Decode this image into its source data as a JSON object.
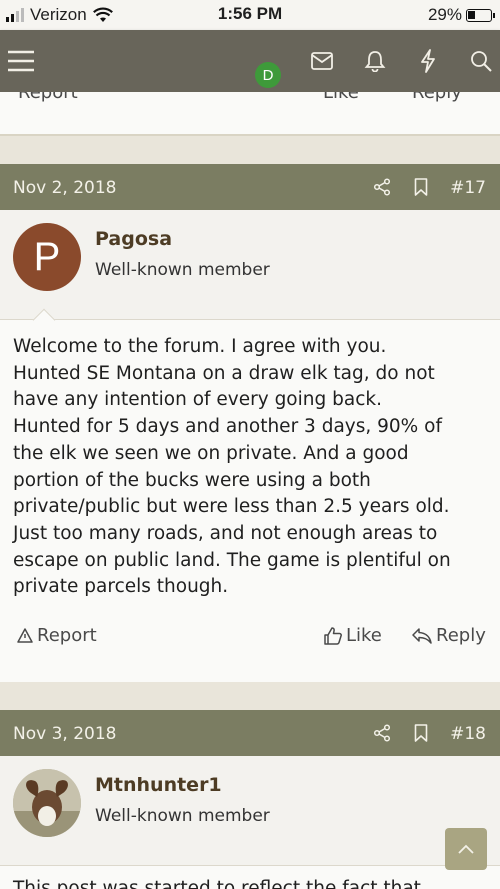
{
  "status_bar": {
    "carrier": "Verizon",
    "time": "1:56 PM",
    "battery": "29%"
  },
  "nav": {
    "user_initial": "D",
    "icons": [
      "menu-icon",
      "inbox-icon",
      "bell-icon",
      "bolt-icon",
      "search-icon"
    ]
  },
  "prev_post": {
    "report": "Report",
    "like": "Like",
    "reply": "Reply"
  },
  "posts": [
    {
      "date": "Nov 2, 2018",
      "number": "#17",
      "avatar_letter": "P",
      "avatar_color": "#8a4a2c",
      "username": "Pagosa",
      "user_title": "Well-known member",
      "lines": [
        "Welcome to the forum. I agree with you.",
        "Hunted SE Montana on a draw elk tag, do not",
        "have any intention of every going back.",
        "Hunted for 5 days and another 3 days, 90% of",
        "the elk we seen we on private. And a good",
        "portion of the bucks were using a both",
        "private/public but were less than 2.5 years old.",
        "Just too many roads, and not enough areas to",
        "escape on public land. The game is plentiful on",
        "private parcels though."
      ],
      "report": "Report",
      "like": "Like",
      "reply": "Reply"
    },
    {
      "date": "Nov 3, 2018",
      "number": "#18",
      "username": "Mtnhunter1",
      "user_title": "Well-known member",
      "body_start": "This post was started to reflect the fact that"
    }
  ],
  "colors": {
    "nav": "#68655a",
    "post_header": "#7b7d62",
    "username": "#4d3c24",
    "avatar_green": "#3e9a3a"
  }
}
